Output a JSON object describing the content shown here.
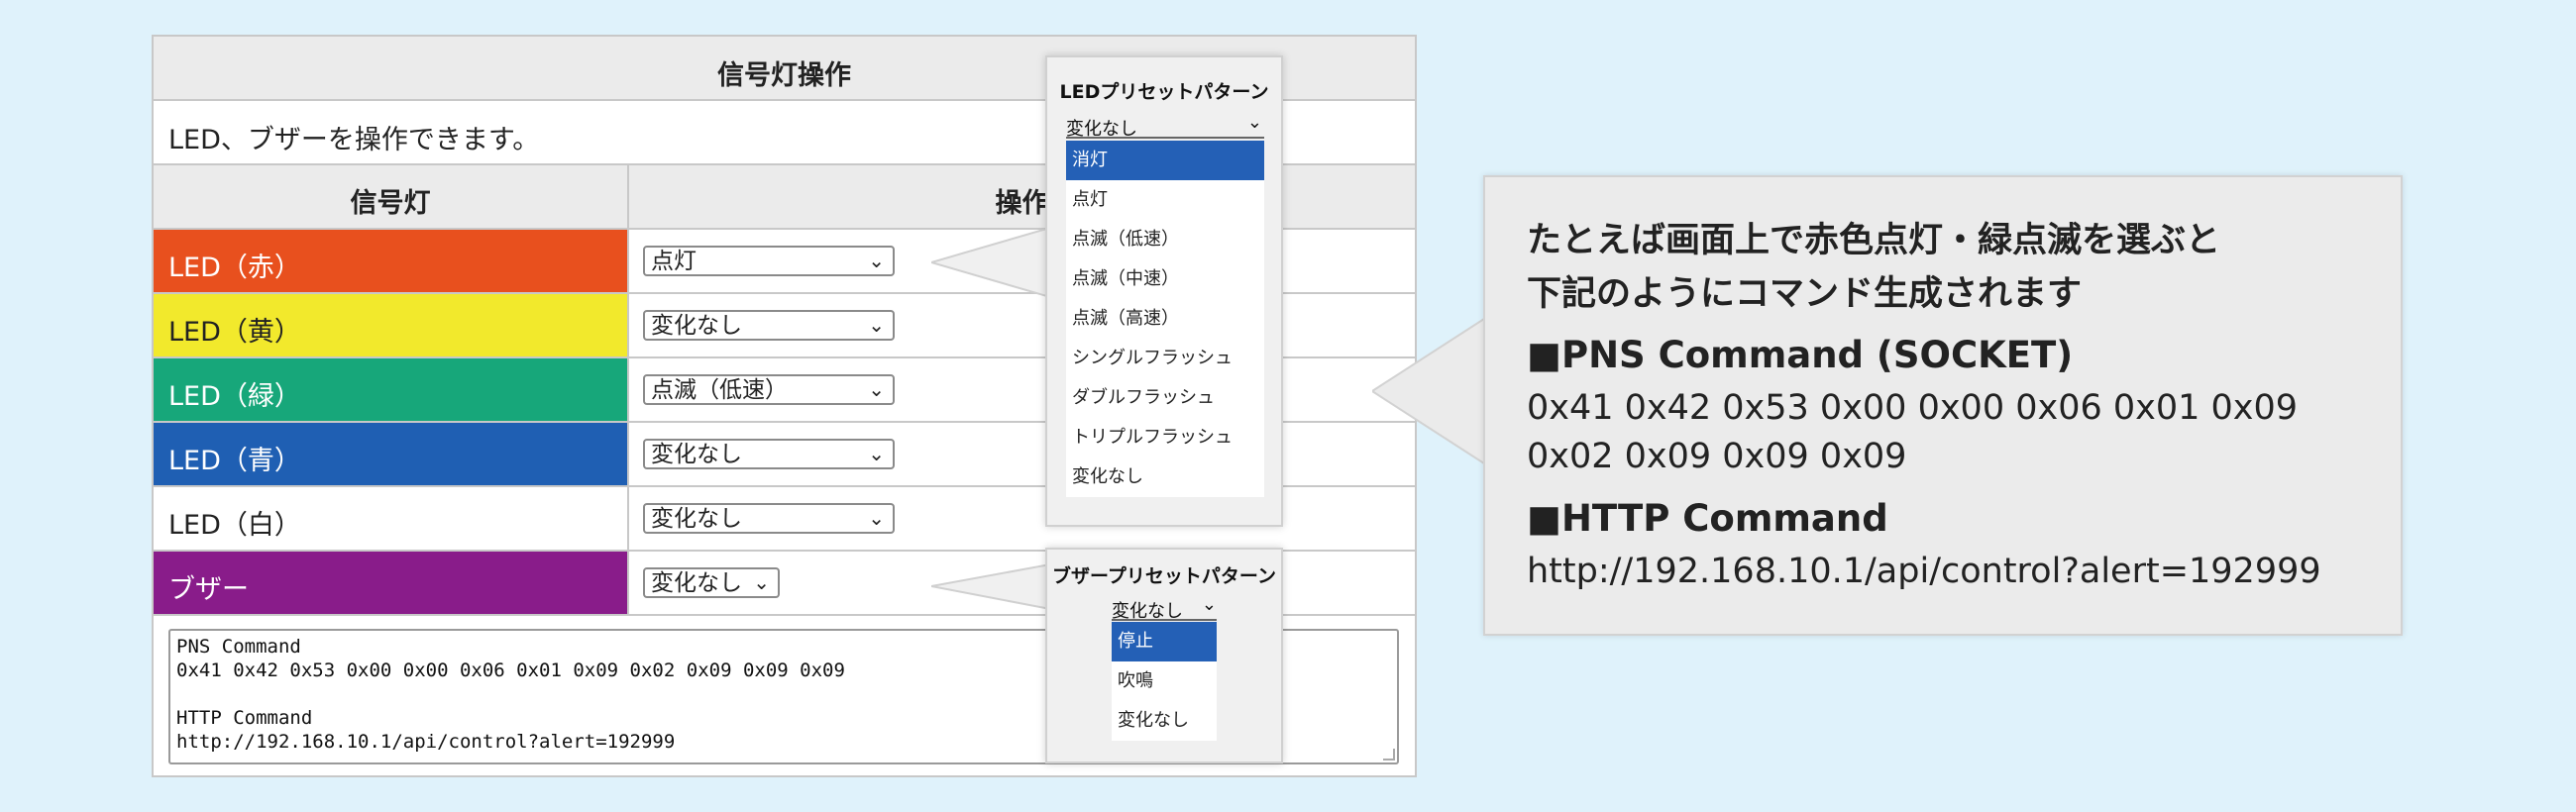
{
  "panel": {
    "title": "信号灯操作",
    "description": "LED、ブザーを操作できます。",
    "col_signal": "信号灯",
    "col_operation": "操作"
  },
  "rows": [
    {
      "label": "LED（赤）",
      "value": "点灯",
      "bg": "#e8501e",
      "fg": "#ffffff"
    },
    {
      "label": "LED（黄）",
      "value": "変化なし",
      "bg": "#f2e92c",
      "fg": "#222222"
    },
    {
      "label": "LED（緑）",
      "value": "点滅（低速）",
      "bg": "#17a77a",
      "fg": "#ffffff"
    },
    {
      "label": "LED（青）",
      "value": "変化なし",
      "bg": "#1f5fb3",
      "fg": "#ffffff"
    },
    {
      "label": "LED（白）",
      "value": "変化なし",
      "bg": "#ffffff",
      "fg": "#222222"
    },
    {
      "label": "ブザー",
      "value": "変化なし",
      "bg": "#891c8a",
      "fg": "#ffffff"
    }
  ],
  "command_box": {
    "line1": "PNS Command",
    "line2": "0x41 0x42 0x53 0x00 0x00 0x06 0x01 0x09 0x02 0x09 0x09 0x09",
    "line3": "HTTP Command",
    "line4": "http://192.168.10.1/api/control?alert=192999"
  },
  "led_popup": {
    "title": "LEDプリセットパターン",
    "selected": "変化なし",
    "options": [
      "消灯",
      "点灯",
      "点滅（低速）",
      "点滅（中速）",
      "点滅（高速）",
      "シングルフラッシュ",
      "ダブルフラッシュ",
      "トリプルフラッシュ",
      "変化なし"
    ],
    "highlighted_index": 0
  },
  "buzzer_popup": {
    "title": "ブザープリセットパターン",
    "selected": "変化なし",
    "options": [
      "停止",
      "吹鳴",
      "変化なし"
    ],
    "highlighted_index": 0
  },
  "callout": {
    "lead1": "たとえば画面上で赤色点灯・緑点滅を選ぶと",
    "lead2": "下記のようにコマンド生成されます",
    "pns_heading": "■PNS Command (SOCKET)",
    "pns_line1": "0x41 0x42 0x53 0x00 0x00 0x06 0x01 0x09",
    "pns_line2": "0x02 0x09 0x09 0x09",
    "http_heading": "■HTTP Command",
    "http_line": "http://192.168.10.1/api/control?alert=192999"
  },
  "icons": {
    "dropdown": "chevron-down-icon"
  },
  "colors": {
    "accent_highlight": "#2460b6",
    "background": "#dff2fb",
    "callout_bg": "#ebebeb"
  }
}
